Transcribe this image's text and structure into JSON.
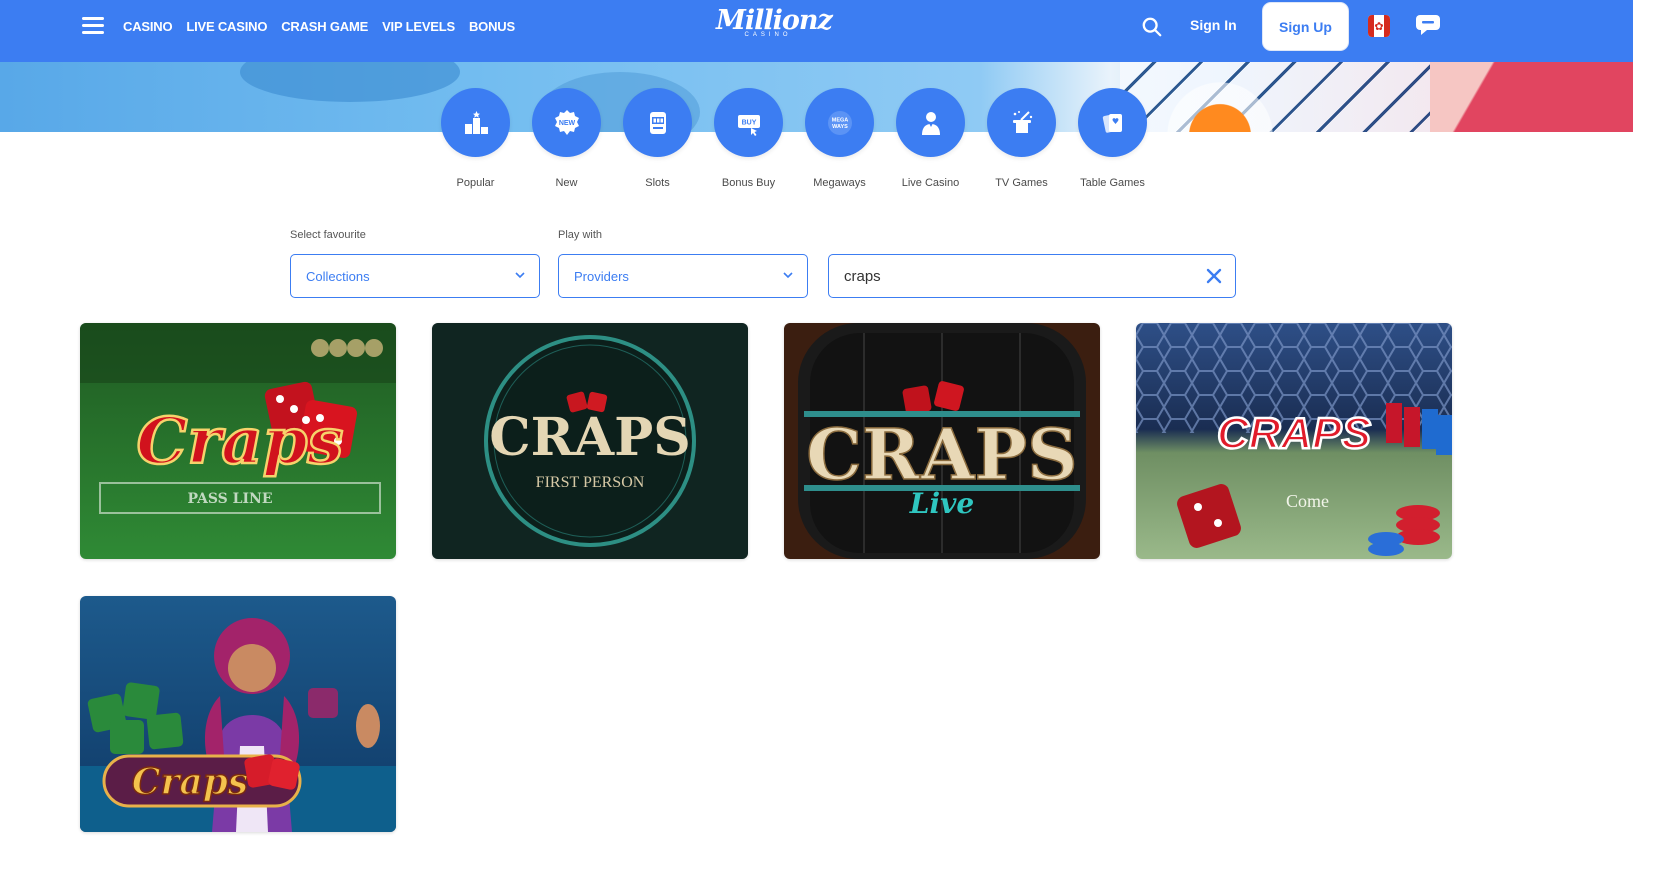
{
  "header": {
    "nav": [
      "CASINO",
      "LIVE CASINO",
      "CRASH GAME",
      "VIP LEVELS",
      "BONUS"
    ],
    "logo_text": "Millionz",
    "logo_sub": "CASINO",
    "signin_label": "Sign In",
    "signup_label": "Sign Up",
    "flag_icon": "canada-flag-icon",
    "chat_icon": "chat-icon"
  },
  "categories": [
    {
      "label": "Popular",
      "icon": "podium-icon"
    },
    {
      "label": "New",
      "icon": "new-badge-icon",
      "text": "NEW"
    },
    {
      "label": "Slots",
      "icon": "slot-machine-icon"
    },
    {
      "label": "Bonus Buy",
      "icon": "bonus-buy-icon",
      "text": "BUY"
    },
    {
      "label": "Megaways",
      "icon": "megaways-icon",
      "text": "MEGA WAYS"
    },
    {
      "label": "Live Casino",
      "icon": "dealer-icon"
    },
    {
      "label": "TV Games",
      "icon": "magic-hat-icon"
    },
    {
      "label": "Table Games",
      "icon": "playing-cards-icon"
    }
  ],
  "filters": {
    "favourite_label": "Select favourite",
    "favourite_value": "Collections",
    "play_with_label": "Play with",
    "play_with_value": "Providers",
    "search_value": "craps"
  },
  "games": [
    {
      "title": "Craps",
      "subtitle": "PASS LINE"
    },
    {
      "title": "CRAPS",
      "subtitle": "FIRST PERSON"
    },
    {
      "title": "CRAPS",
      "subtitle": "Live"
    },
    {
      "title": "CRAPS",
      "subtitle": "Come"
    },
    {
      "title": "Craps",
      "subtitle": ""
    }
  ],
  "colors": {
    "brand": "#3c7df2",
    "text": "#4a4a4a"
  }
}
